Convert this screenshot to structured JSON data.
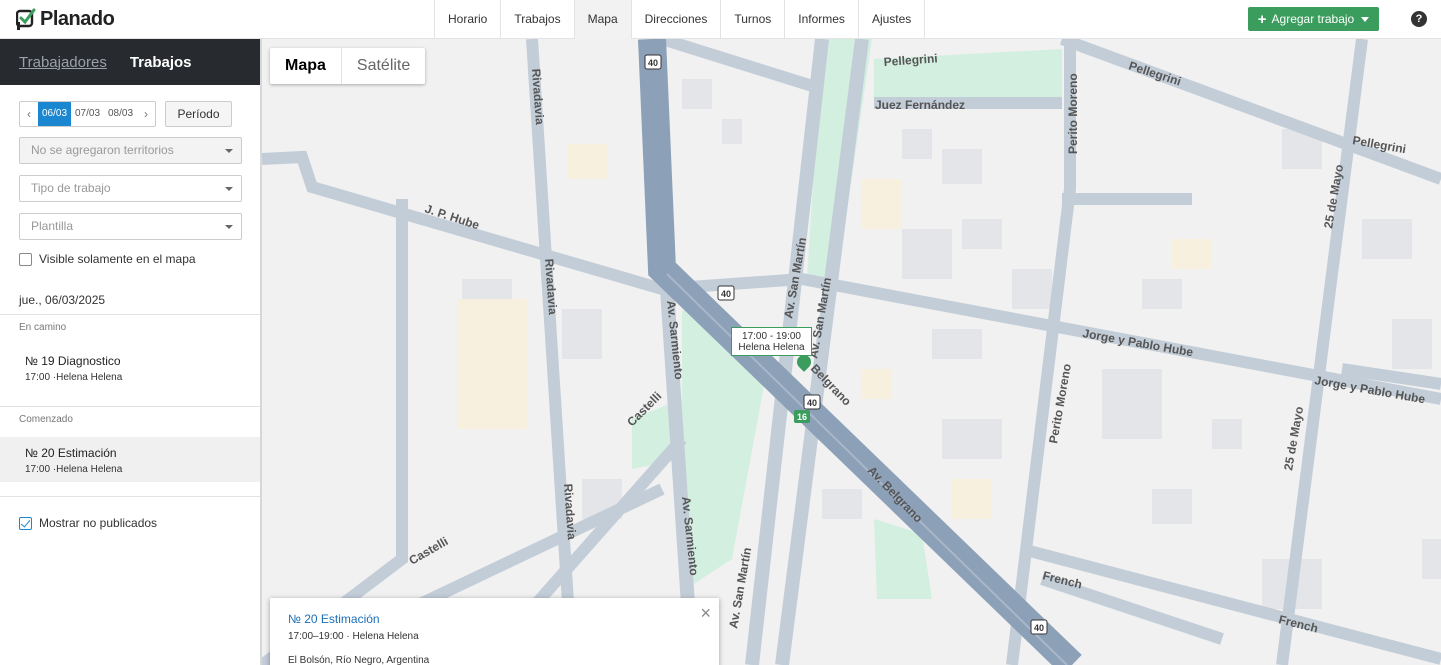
{
  "brand": {
    "name": "Planado"
  },
  "nav": {
    "items": [
      "Horario",
      "Trabajos",
      "Mapa",
      "Direcciones",
      "Turnos",
      "Informes",
      "Ajustes"
    ],
    "active": "Mapa"
  },
  "actions": {
    "add_job": "Agregar trabajo",
    "help": "?"
  },
  "sidebar": {
    "tabs": {
      "workers": "Trabajadores",
      "jobs": "Trabajos"
    },
    "dates": {
      "prev": "‹",
      "next": "›",
      "days": [
        "06/03",
        "07/03",
        "08/03"
      ],
      "active": "06/03"
    },
    "period_button": "Período",
    "filters": {
      "territories": "No se agregaron territorios",
      "job_type": "Tipo de trabajo",
      "template": "Plantilla"
    },
    "visible_on_map": {
      "label": "Visible solamente en el mapa",
      "checked": false
    },
    "current_date": "jue., 06/03/2025",
    "groups": [
      {
        "label": "En camino",
        "jobs": [
          {
            "title": "№ 19 Diagnostico",
            "sub": "17:00 ·Helena Helena"
          }
        ]
      },
      {
        "label": "Comenzado",
        "jobs": [
          {
            "title": "№ 20 Estimación",
            "sub": "17:00 ·Helena Helena"
          }
        ]
      }
    ],
    "show_unpublished": {
      "label": "Mostrar no publicados",
      "checked": true
    }
  },
  "map": {
    "type_buttons": {
      "map": "Mapa",
      "satellite": "Satélite"
    },
    "marker": {
      "time": "17:00 - 19:00",
      "worker": "Helena Helena"
    },
    "streets": {
      "pellegrini": "Pellegrini",
      "juez": "Juez Fernández",
      "perito": "Perito Moreno",
      "hube": "J. P. Hube",
      "rivadavia": "Rivadavia",
      "sanmartin": "Av. San Martín",
      "sarmiento": "Av. Sarmiento",
      "belgrano": "Belgrano",
      "avbelgrano": "Av. Belgrano",
      "castelli": "Castelli",
      "jorge": "Jorge y Pablo Hube",
      "mayo": "25 de Mayo",
      "french": "French"
    },
    "shields": {
      "route40": "40",
      "route16": "16"
    },
    "colors": {
      "road_major": "#8ca0b8",
      "road": "#c3cdd8",
      "park": "#d3efe0",
      "background": "#f1f1f1"
    },
    "info_window": {
      "title": "№ 20 Estimación",
      "sub": "17:00–19:00 · Helena Helena",
      "address": "El Bolsón, Río Negro, Argentina",
      "close": "×"
    }
  }
}
